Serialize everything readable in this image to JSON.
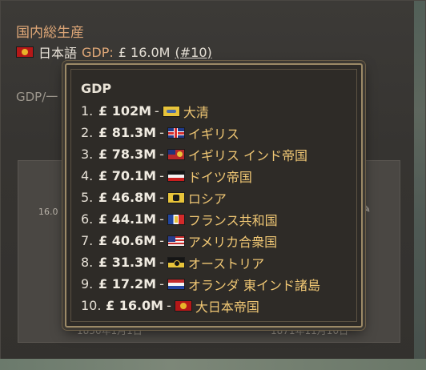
{
  "panel": {
    "title": "国内総生産",
    "country_name": "日本語",
    "gdp_label": "GDP:",
    "gdp_value": "£ 16.0M",
    "rank": "(#10)",
    "subtitle": "GDP/一",
    "chart_tick": "16.0",
    "x_left": "1836年1月1日",
    "x_right": "1871年11月10日"
  },
  "tooltip": {
    "title": "GDP",
    "rows": [
      {
        "rank": "1.",
        "amount": "£ 102M",
        "sep": "-",
        "flag": "qing-flag-icon",
        "name": "大清"
      },
      {
        "rank": "2.",
        "amount": "£ 81.3M",
        "sep": "-",
        "flag": "uk-flag-icon",
        "name": "イギリス"
      },
      {
        "rank": "3.",
        "amount": "£ 78.3M",
        "sep": "-",
        "flag": "british-india-flag-icon",
        "name": "イギリス インド帝国"
      },
      {
        "rank": "4.",
        "amount": "£ 70.1M",
        "sep": "-",
        "flag": "germany-flag-icon",
        "name": "ドイツ帝国"
      },
      {
        "rank": "5.",
        "amount": "£ 46.8M",
        "sep": "-",
        "flag": "russia-flag-icon",
        "name": "ロシア"
      },
      {
        "rank": "6.",
        "amount": "£ 44.1M",
        "sep": "-",
        "flag": "france-flag-icon",
        "name": "フランス共和国"
      },
      {
        "rank": "7.",
        "amount": "£ 40.6M",
        "sep": "-",
        "flag": "usa-flag-icon",
        "name": "アメリカ合衆国"
      },
      {
        "rank": "8.",
        "amount": "£ 31.3M",
        "sep": "-",
        "flag": "austria-flag-icon",
        "name": "オーストリア"
      },
      {
        "rank": "9.",
        "amount": "£ 17.2M",
        "sep": "-",
        "flag": "netherlands-flag-icon",
        "name": "オランダ 東インド諸島"
      },
      {
        "rank": "10.",
        "amount": "£ 16.0M",
        "sep": "-",
        "flag": "japan-flag-icon",
        "name": "大日本帝国"
      }
    ]
  },
  "colors": {
    "accent": "#e0a878",
    "name_gold": "#f0c774",
    "border_gold": "#9c8a67"
  }
}
